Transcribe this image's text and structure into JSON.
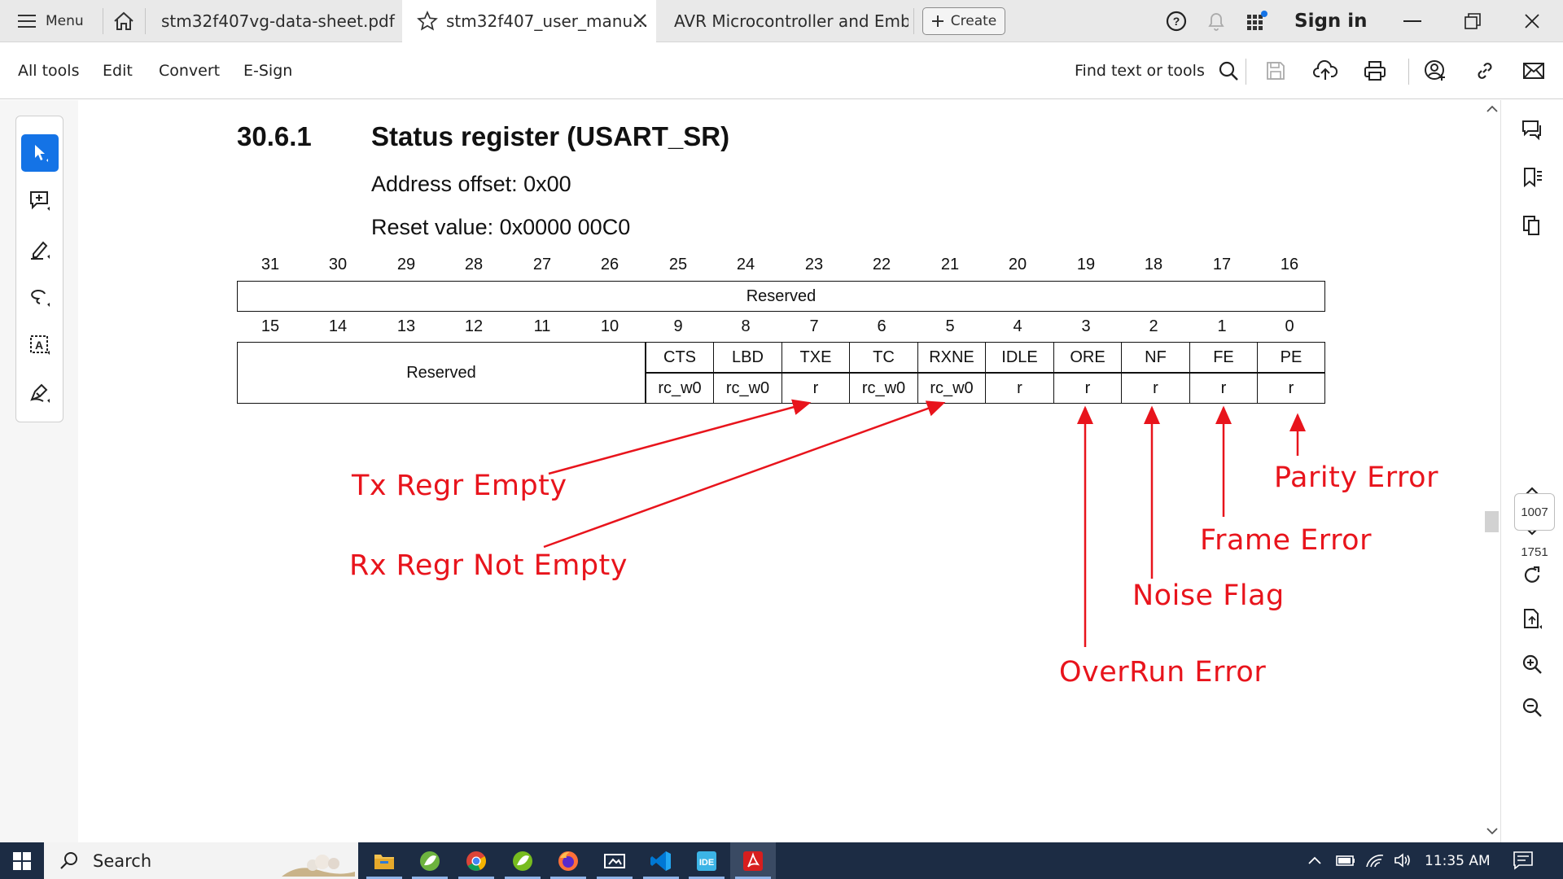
{
  "tabbar": {
    "menu_label": "Menu",
    "tabs": [
      {
        "label": "stm32f407vg-data-sheet.pdf"
      },
      {
        "label": "stm32f407_user_manu..."
      },
      {
        "label": "AVR Microcontroller and Embe..."
      }
    ],
    "create_label": "Create",
    "sign_in_label": "Sign in"
  },
  "toolbar": {
    "menus": [
      "All tools",
      "Edit",
      "Convert",
      "E-Sign"
    ],
    "find_label": "Find text or tools"
  },
  "document": {
    "section_number": "30.6.1",
    "section_title": "Status register (USART_SR)",
    "address_offset": "Address offset: 0x00",
    "reset_value": "Reset value: 0x0000 00C0",
    "bits_high": [
      "31",
      "30",
      "29",
      "28",
      "27",
      "26",
      "25",
      "24",
      "23",
      "22",
      "21",
      "20",
      "19",
      "18",
      "17",
      "16"
    ],
    "bits_low": [
      "15",
      "14",
      "13",
      "12",
      "11",
      "10",
      "9",
      "8",
      "7",
      "6",
      "5",
      "4",
      "3",
      "2",
      "1",
      "0"
    ],
    "reserved_high": "Reserved",
    "reserved_low": "Reserved",
    "fields": [
      {
        "name": "CTS",
        "access": "rc_w0"
      },
      {
        "name": "LBD",
        "access": "rc_w0"
      },
      {
        "name": "TXE",
        "access": "r"
      },
      {
        "name": "TC",
        "access": "rc_w0"
      },
      {
        "name": "RXNE",
        "access": "rc_w0"
      },
      {
        "name": "IDLE",
        "access": "r"
      },
      {
        "name": "ORE",
        "access": "r"
      },
      {
        "name": "NF",
        "access": "r"
      },
      {
        "name": "FE",
        "access": "r"
      },
      {
        "name": "PE",
        "access": "r"
      }
    ]
  },
  "annotations": {
    "tx": "Tx Regr Empty",
    "rx": "Rx Regr Not Empty",
    "ore": "OverRun Error",
    "nf": "Noise Flag",
    "fe": "Frame Error",
    "pe": "Parity Error",
    "color": "#e8141c"
  },
  "right_panel": {
    "current_page": "1007",
    "total_pages": "1751"
  },
  "taskbar": {
    "search_label": "Search",
    "time": "11:35 AM"
  },
  "icons": [
    "hamburger-icon",
    "home-icon",
    "star-icon",
    "close-icon",
    "plus-icon",
    "help-icon",
    "bell-icon",
    "apps-icon",
    "minimize-icon",
    "restore-icon",
    "window-close-icon",
    "search-icon",
    "save-icon",
    "cloud-upload-icon",
    "print-icon",
    "share-user-icon",
    "link-icon",
    "mail-icon",
    "select-arrow-icon",
    "add-comment-icon",
    "highlight-pen-icon",
    "lasso-draw-icon",
    "text-recognition-icon",
    "sign-pen-icon",
    "comments-icon",
    "bookmarks-icon",
    "pages-icon",
    "chevron-up-icon",
    "chevron-down-icon",
    "refresh-icon",
    "file-export-icon",
    "zoom-in-icon",
    "zoom-out-icon",
    "windows-start-icon"
  ]
}
